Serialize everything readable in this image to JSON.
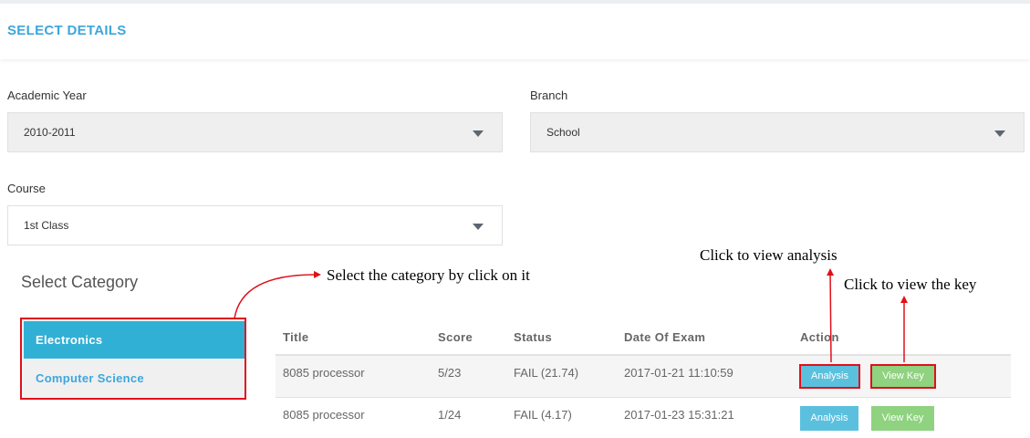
{
  "header": {
    "title": "SELECT DETAILS"
  },
  "form": {
    "academic_year": {
      "label": "Academic Year",
      "value": "2010-2011"
    },
    "branch": {
      "label": "Branch",
      "value": "School"
    },
    "course": {
      "label": "Course",
      "value": "1st Class"
    }
  },
  "category": {
    "title": "Select Category",
    "items": [
      {
        "label": "Electronics",
        "active": true
      },
      {
        "label": "Computer Science",
        "active": false
      }
    ]
  },
  "annotations": {
    "category": "Select the category by click on it",
    "analysis": "Click to view analysis",
    "key": "Click to view the key"
  },
  "table": {
    "columns": [
      "Title",
      "Score",
      "Status",
      "Date Of Exam",
      "Action"
    ],
    "rows": [
      {
        "title": "8085 processor",
        "score": "5/23",
        "status": "FAIL (21.74)",
        "date": "2017-01-21 11:10:59",
        "analysis": "Analysis",
        "key": "View Key"
      },
      {
        "title": "8085 processor",
        "score": "1/24",
        "status": "FAIL (4.17)",
        "date": "2017-01-23 15:31:21",
        "analysis": "Analysis",
        "key": "View Key"
      }
    ]
  },
  "colors": {
    "accent": "#3ea6dc",
    "active_category": "#31b0d5",
    "analysis_button": "#5bc0de",
    "key_button": "#8fd27f",
    "annotation": "#e0101a"
  }
}
